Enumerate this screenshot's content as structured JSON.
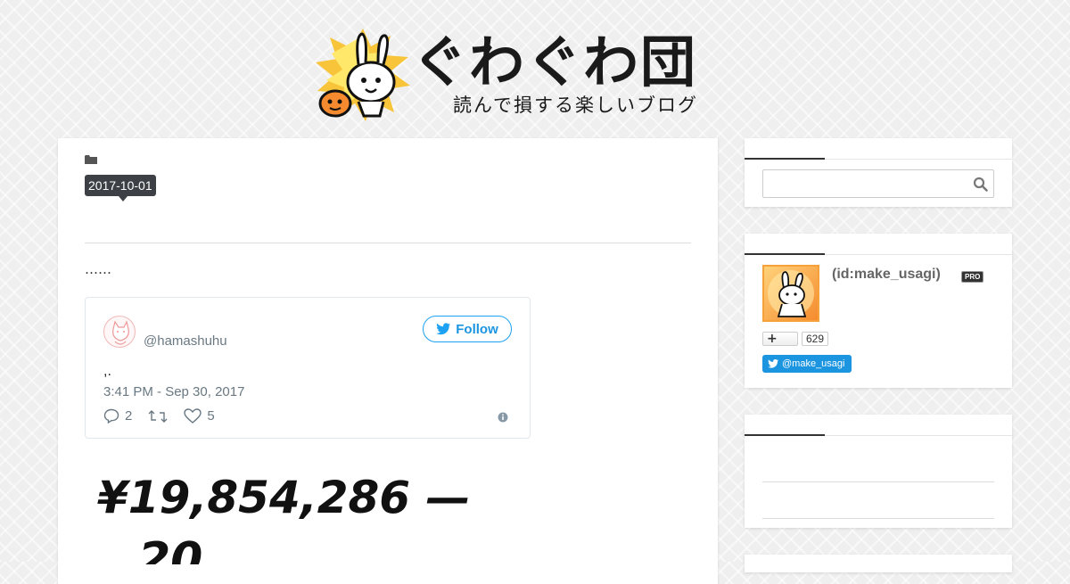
{
  "header": {
    "title": "ぐわぐわ団",
    "tagline": "読んで損する楽しいブログ"
  },
  "article": {
    "date": "2017-10-01",
    "intro_text": "……",
    "tweet": {
      "handle": "@hamashuhu",
      "follow_label": "Follow",
      "text": ",.",
      "timestamp": "3:41 PM - Sep 30, 2017",
      "reply_count": "2",
      "like_count": "5"
    },
    "handwritten_text": "¥19,854,286 —"
  },
  "sidebar": {
    "profile": {
      "id_text": "(id:make_usagi)",
      "pro_label": "PRO",
      "subscriber_count": "629",
      "twitter_label": "@make_usagi"
    }
  },
  "colors": {
    "accent_blue": "#1b95e0",
    "date_badge": "#3d4145",
    "profile_orange": "#f7a13a"
  }
}
